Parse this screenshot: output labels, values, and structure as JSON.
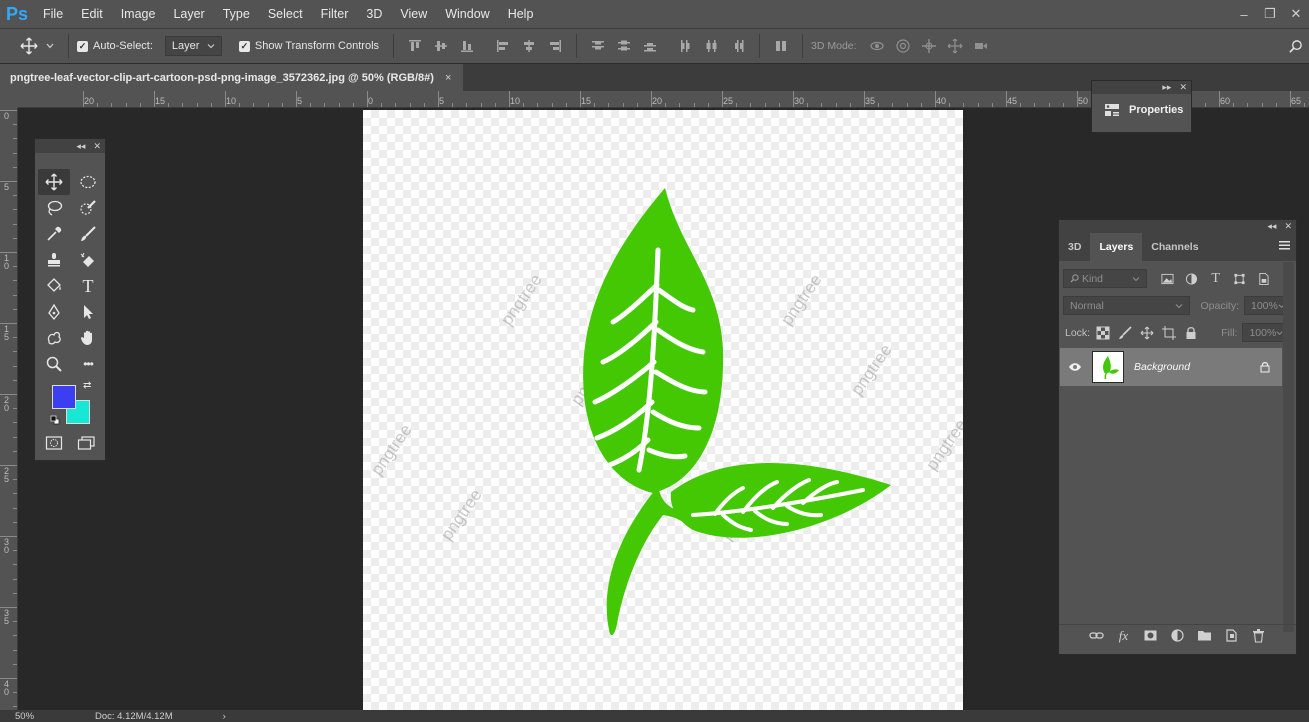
{
  "app": {
    "logo": "Ps"
  },
  "menu": [
    "File",
    "Edit",
    "Image",
    "Layer",
    "Type",
    "Select",
    "Filter",
    "3D",
    "View",
    "Window",
    "Help"
  ],
  "window_controls": {
    "minimize": "–",
    "restore": "❐",
    "close": "✕"
  },
  "options": {
    "auto_select_label": "Auto-Select:",
    "auto_select_value": "Layer",
    "transform_label": "Show Transform Controls",
    "mode_3d_label": "3D Mode:"
  },
  "document": {
    "tab_title": "pngtree-leaf-vector-clip-art-cartoon-psd-png-image_3572362.jpg @ 50% (RGB/8#)",
    "close": "×",
    "watermark": "pngtree"
  },
  "ruler": {
    "top_ticks": [
      "20",
      "15",
      "10",
      "5",
      "0",
      "5",
      "10",
      "15",
      "20",
      "25",
      "30",
      "35",
      "40",
      "45",
      "50",
      "55",
      "60",
      "65"
    ],
    "left_ticks": [
      "0",
      "5",
      "1\n0",
      "1\n5",
      "2\n0",
      "2\n5",
      "3\n0",
      "3\n5",
      "4\n0"
    ]
  },
  "status": {
    "zoom": "50%",
    "doc": "Doc: 4.12M/4.12M",
    "arrow": "›"
  },
  "colors": {
    "foreground": "#3b3ff0",
    "background": "#16e8d5",
    "leaf": "#43c803",
    "ps_blue": "#31a8ff"
  },
  "panels": {
    "collapse": "◂◂",
    "expand": "▸▸",
    "close": "✕",
    "properties": {
      "label": "Properties"
    },
    "layers": {
      "tabs": [
        "3D",
        "Layers",
        "Channels"
      ],
      "kind_label": "Kind",
      "blend_mode": "Normal",
      "opacity_label": "Opacity:",
      "opacity_value": "100%",
      "lock_label": "Lock:",
      "fill_label": "Fill:",
      "fill_value": "100%",
      "layer_name": "Background",
      "footer_fx": "fx"
    }
  },
  "tools": {
    "type_glyph": "T",
    "more_glyph": "•••",
    "swap_glyph": "⇄"
  }
}
